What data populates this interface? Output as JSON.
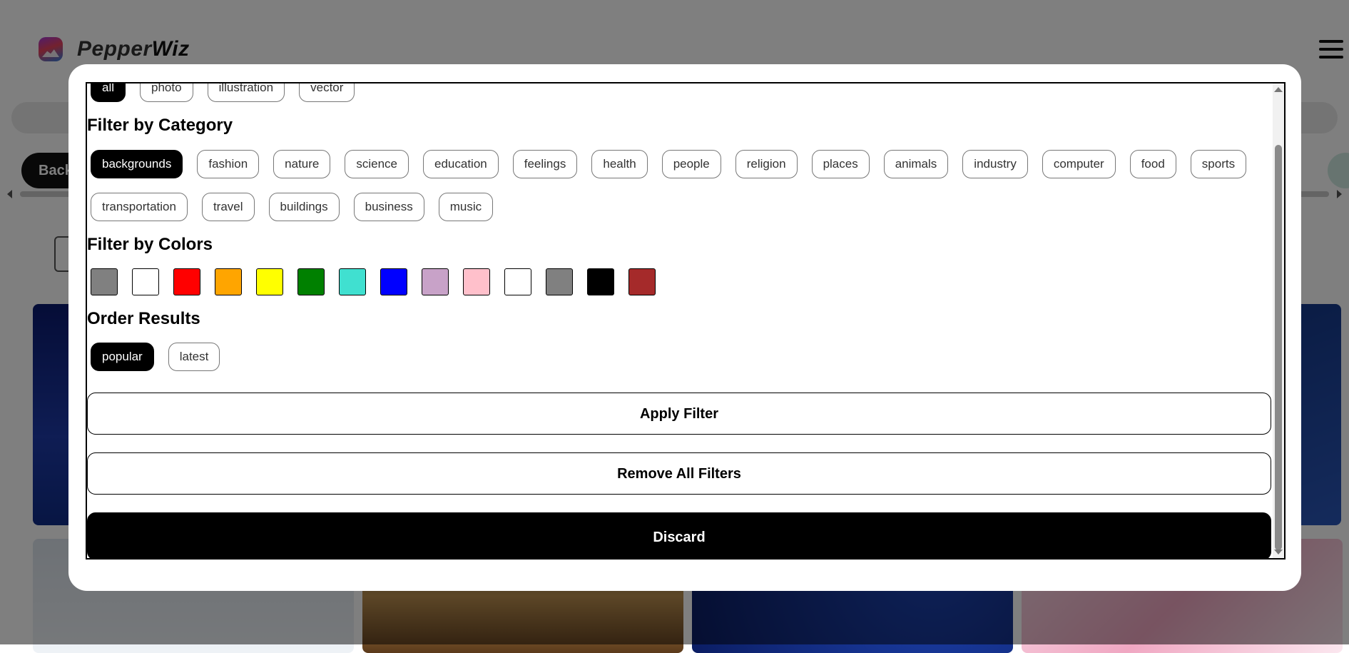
{
  "app": {
    "brand_light": "Pepper",
    "brand_bold": "Wiz",
    "background_pill": "Back"
  },
  "filter": {
    "types": [
      {
        "label": "all",
        "active": true
      },
      {
        "label": "photo",
        "active": false
      },
      {
        "label": "illustration",
        "active": false
      },
      {
        "label": "vector",
        "active": false
      }
    ],
    "category_title": "Filter by Category",
    "categories": [
      {
        "label": "backgrounds",
        "active": true
      },
      {
        "label": "fashion",
        "active": false
      },
      {
        "label": "nature",
        "active": false
      },
      {
        "label": "science",
        "active": false
      },
      {
        "label": "education",
        "active": false
      },
      {
        "label": "feelings",
        "active": false
      },
      {
        "label": "health",
        "active": false
      },
      {
        "label": "people",
        "active": false
      },
      {
        "label": "religion",
        "active": false
      },
      {
        "label": "places",
        "active": false
      },
      {
        "label": "animals",
        "active": false
      },
      {
        "label": "industry",
        "active": false
      },
      {
        "label": "computer",
        "active": false
      },
      {
        "label": "food",
        "active": false
      },
      {
        "label": "sports",
        "active": false
      },
      {
        "label": "transportation",
        "active": false
      },
      {
        "label": "travel",
        "active": false
      },
      {
        "label": "buildings",
        "active": false
      },
      {
        "label": "business",
        "active": false
      },
      {
        "label": "music",
        "active": false
      }
    ],
    "colors_title": "Filter by Colors",
    "colors": [
      {
        "name": "grayscale",
        "hex": "#808080"
      },
      {
        "name": "transparent",
        "hex": "#ffffff"
      },
      {
        "name": "red",
        "hex": "#ff0000"
      },
      {
        "name": "orange",
        "hex": "#ffa500"
      },
      {
        "name": "yellow",
        "hex": "#ffff00"
      },
      {
        "name": "green",
        "hex": "#008000"
      },
      {
        "name": "turquoise",
        "hex": "#40e0d0"
      },
      {
        "name": "blue",
        "hex": "#0000ff"
      },
      {
        "name": "lilac",
        "hex": "#c8a2c8"
      },
      {
        "name": "pink",
        "hex": "#ffc0cb"
      },
      {
        "name": "white",
        "hex": "#ffffff"
      },
      {
        "name": "gray",
        "hex": "#808080"
      },
      {
        "name": "black",
        "hex": "#000000"
      },
      {
        "name": "brown",
        "hex": "#a52a2a"
      }
    ],
    "order_title": "Order Results",
    "orders": [
      {
        "label": "popular",
        "active": true
      },
      {
        "label": "latest",
        "active": false
      }
    ],
    "apply_label": "Apply Filter",
    "remove_label": "Remove All Filters",
    "discard_label": "Discard"
  }
}
